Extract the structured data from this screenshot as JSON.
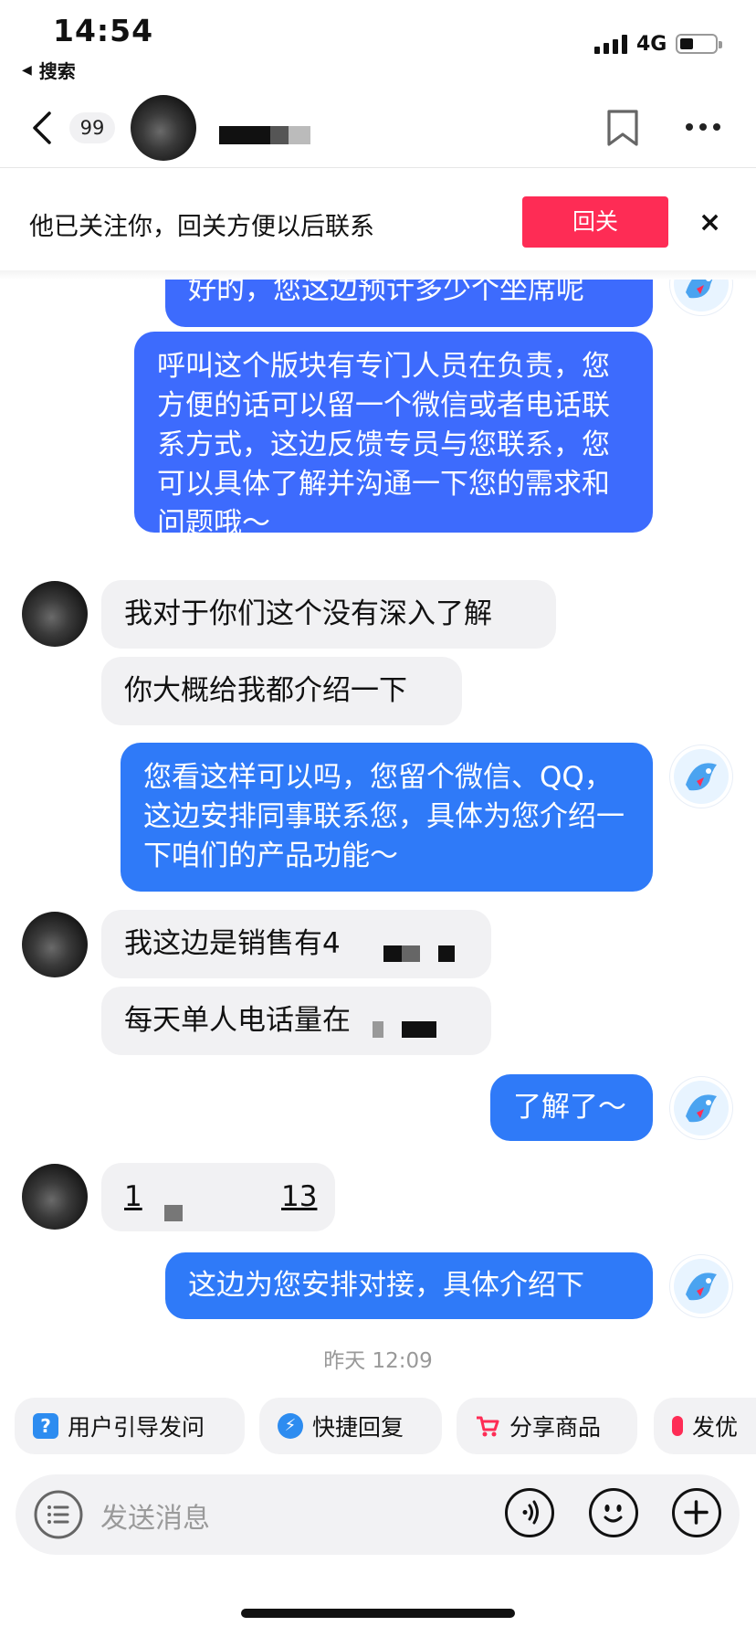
{
  "status_bar": {
    "time": "14:54",
    "back_app": "搜索",
    "network": "4G"
  },
  "nav": {
    "unread_count": "99"
  },
  "follow_banner": {
    "text": "他已关注你，回关方便以后联系",
    "button": "回关",
    "close": "×"
  },
  "messages": [
    {
      "side": "out",
      "text": "好的，您这边预计多少个坐席呢"
    },
    {
      "side": "out",
      "text": "呼叫这个版块有专门人员在负责，您方便的话可以留一个微信或者电话联系方式，这边反馈专员与您联系，您可以具体了解并沟通一下您的需求和问题哦～"
    },
    {
      "side": "in",
      "text": "我对于你们这个没有深入了解"
    },
    {
      "side": "in",
      "text": "你大概给我都介绍一下"
    },
    {
      "side": "out",
      "text": "您看这样可以吗，您留个微信、QQ，这边安排同事联系您，具体为您介绍一下咱们的产品功能～"
    },
    {
      "side": "in",
      "text": "我这边是销售有4"
    },
    {
      "side": "in",
      "text": "每天单人电话量在"
    },
    {
      "side": "out",
      "text": "了解了～"
    },
    {
      "side": "in",
      "text_start": "1",
      "text_end": "13"
    },
    {
      "side": "out",
      "text": "这边为您安排对接，具体介绍下"
    }
  ],
  "timestamp": "昨天 12:09",
  "quick_actions": [
    {
      "label": "用户引导发问",
      "icon": "question-icon",
      "color": "#2d8cf0"
    },
    {
      "label": "快捷回复",
      "icon": "lightning-icon",
      "color": "#2d8cf0"
    },
    {
      "label": "分享商品",
      "icon": "cart-icon",
      "color": "#fe2c55"
    },
    {
      "label": "发优",
      "icon": "coupon-icon",
      "color": "#fe2c55"
    }
  ],
  "input": {
    "placeholder": "发送消息"
  },
  "colors": {
    "outgoing_bubble": "#3d6bfd",
    "incoming_bubble": "#f1f1f3",
    "accent": "#fe2c55"
  }
}
